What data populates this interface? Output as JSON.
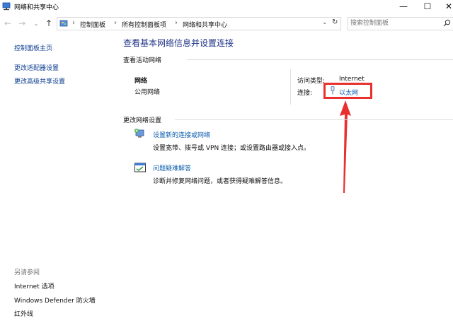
{
  "window": {
    "title": "网络和共享中心"
  },
  "titlebar_buttons": {
    "minimize": "—",
    "maximize": "☐",
    "close": "✕"
  },
  "address": {
    "crumbs": [
      "控制面板",
      "所有控制面板项",
      "网络和共享中心"
    ],
    "search_placeholder": "搜索控制面板"
  },
  "sidebar": {
    "links": [
      "控制面板主页",
      "更改适配器设置",
      "更改高级共享设置"
    ],
    "see_also_title": "另请参阅",
    "see_also": [
      "Internet 选项",
      "Windows Defender 防火墙",
      "红外线"
    ]
  },
  "main": {
    "title": "查看基本网络信息并设置连接",
    "active_header": "查看活动网络",
    "network_name": "网络",
    "network_type": "公用网络",
    "access_type_label": "访问类型:",
    "access_type_value": "Internet",
    "connections_label": "连接:",
    "connection_name": "以太网",
    "change_header": "更改网络设置",
    "tasks": [
      {
        "title": "设置新的连接或网络",
        "desc": "设置宽带、拨号或 VPN 连接；或设置路由器或接入点。"
      },
      {
        "title": "问题疑难解答",
        "desc": "诊断并修复网络问题，或者获得疑难解答信息。"
      }
    ]
  },
  "colors": {
    "link": "#0b5cad",
    "title": "#1e3287",
    "annotation": "#e8302e"
  }
}
